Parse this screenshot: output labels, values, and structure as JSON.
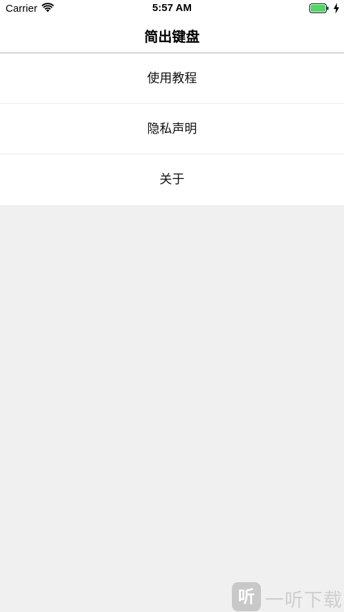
{
  "status_bar": {
    "carrier": "Carrier",
    "time": "5:57 AM",
    "battery_color": "#4cd964",
    "icons": [
      "wifi-icon",
      "battery-icon",
      "charging-icon"
    ]
  },
  "nav": {
    "title": "简出键盘"
  },
  "menu": {
    "items": [
      {
        "label": "使用教程"
      },
      {
        "label": "隐私声明"
      },
      {
        "label": "关于"
      }
    ]
  },
  "watermark": {
    "logo_text": "听",
    "text": "一听下载"
  }
}
